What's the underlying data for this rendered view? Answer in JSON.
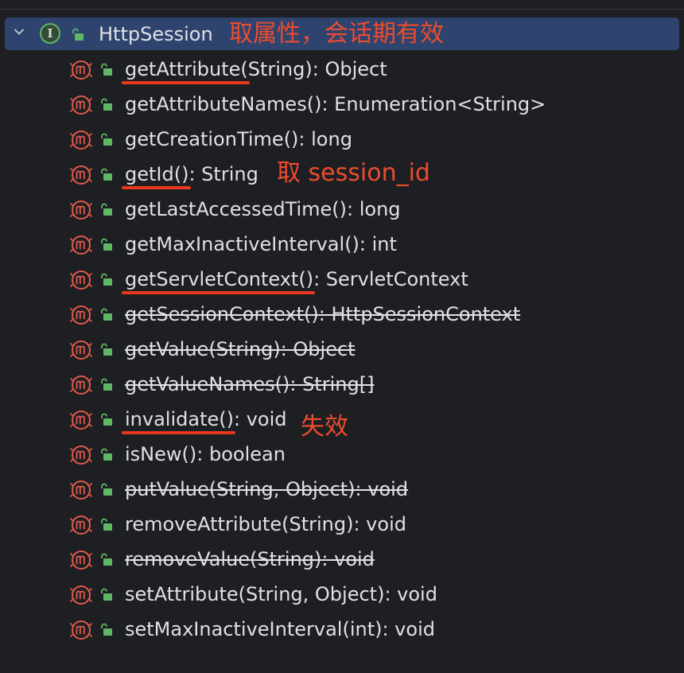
{
  "class": {
    "name": "HttpSession",
    "kind_icon": "interface-icon",
    "kind_letter": "I",
    "expanded": true
  },
  "annotations": {
    "class_note": "取属性，会话期有效",
    "id_note": "取 session_id",
    "invalidate_note": "失效"
  },
  "methods": [
    {
      "name": "getAttribute",
      "params": "(String)",
      "ret": ": Object",
      "deprecated": false,
      "underlined": true
    },
    {
      "name": "getAttributeNames",
      "params": "()",
      "ret": ": Enumeration<String>",
      "deprecated": false,
      "underlined": false
    },
    {
      "name": "getCreationTime",
      "params": "()",
      "ret": ": long",
      "deprecated": false,
      "underlined": false
    },
    {
      "name": "getId",
      "params": "()",
      "ret": ": String",
      "deprecated": false,
      "underlined": true
    },
    {
      "name": "getLastAccessedTime",
      "params": "()",
      "ret": ": long",
      "deprecated": false,
      "underlined": false
    },
    {
      "name": "getMaxInactiveInterval",
      "params": "()",
      "ret": ": int",
      "deprecated": false,
      "underlined": false
    },
    {
      "name": "getServletContext",
      "params": "()",
      "ret": ": ServletContext",
      "deprecated": false,
      "underlined": true
    },
    {
      "name": "getSessionContext",
      "params": "()",
      "ret": ": HttpSessionContext",
      "deprecated": true,
      "underlined": false
    },
    {
      "name": "getValue",
      "params": "(String)",
      "ret": ": Object",
      "deprecated": true,
      "underlined": false
    },
    {
      "name": "getValueNames",
      "params": "()",
      "ret": ": String[]",
      "deprecated": true,
      "underlined": false
    },
    {
      "name": "invalidate",
      "params": "()",
      "ret": ": void",
      "deprecated": false,
      "underlined": true
    },
    {
      "name": "isNew",
      "params": "()",
      "ret": ": boolean",
      "deprecated": false,
      "underlined": false
    },
    {
      "name": "putValue",
      "params": "(String, Object)",
      "ret": ": void",
      "deprecated": true,
      "underlined": false
    },
    {
      "name": "removeAttribute",
      "params": "(String)",
      "ret": ": void",
      "deprecated": false,
      "underlined": false
    },
    {
      "name": "removeValue",
      "params": "(String)",
      "ret": ": void",
      "deprecated": true,
      "underlined": false
    },
    {
      "name": "setAttribute",
      "params": "(String, Object)",
      "ret": ": void",
      "deprecated": false,
      "underlined": false
    },
    {
      "name": "setMaxInactiveInterval",
      "params": "(int)",
      "ret": ": void",
      "deprecated": false,
      "underlined": false
    }
  ],
  "colors": {
    "background": "#1e1f22",
    "selection": "#2e436e",
    "text": "#dfe1e5",
    "method_icon": "#e05a4a",
    "lock_icon": "#5fb865",
    "annotation": "#eb4c2e"
  },
  "icons": {
    "method": "method-m-icon",
    "visibility": "public-lock-icon",
    "expander": "chevron-down-icon"
  }
}
